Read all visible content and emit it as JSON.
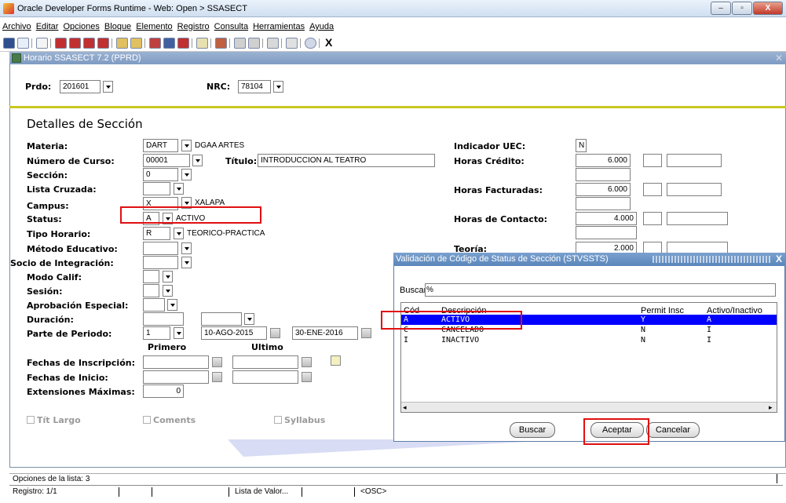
{
  "window": {
    "title": "Oracle Developer Forms Runtime - Web: Open > SSASECT",
    "min": "–",
    "max": "▫",
    "close": "X"
  },
  "menu": [
    "Archivo",
    "Editar",
    "Opciones",
    "Bloque",
    "Elemento",
    "Registro",
    "Consulta",
    "Herramientas",
    "Ayuda"
  ],
  "toolbar": {
    "exit_label": "X"
  },
  "form": {
    "title": "Horario  SSASECT 7.2  (PPRD)",
    "prdo_label": "Prdo:",
    "prdo_value": "201601",
    "nrc_label": "NRC:",
    "nrc_value": "78104",
    "section_title": "Detalles de Sección",
    "materia_label": "Materia:",
    "materia_code": "DART",
    "materia_desc": "DGAA ARTES",
    "curso_label": "Número de Curso:",
    "curso_value": "00001",
    "titulo_label": "Título:",
    "titulo_value": "INTRODUCCION AL TEATRO",
    "seccion_label": "Sección:",
    "seccion_value": "0",
    "lista_label": "Lista Cruzada:",
    "campus_label": "Campus:",
    "campus_code": "X",
    "campus_desc": "XALAPA",
    "status_label": "Status:",
    "status_code": "A",
    "status_desc": "ACTIVO",
    "tipo_label": "Tipo Horario:",
    "tipo_code": "R",
    "tipo_desc": "TEORICO-PRACTICA",
    "metodo_label": "Método Educativo:",
    "socio_label": "Socio  de  Integración:",
    "modo_label": "Modo Calif:",
    "sesion_label": "Sesión:",
    "aprob_label": "Aprobación Especial:",
    "duracion_label": "Duración:",
    "parte_label": "Parte de Periodo:",
    "parte_value": "1",
    "fecha_ini": "10-AGO-2015",
    "fecha_fin": "30-ENE-2016",
    "primero_label": "Primero",
    "ultimo_label": "Ultimo",
    "fechas_insc_label": "Fechas de Inscripción:",
    "fechas_inicio_label": "Fechas de Inicio:",
    "ext_label": "Extensiones Máximas:",
    "ext_value": "0",
    "uec_label": "Indicador UEC:",
    "uec_value": "N",
    "horas_credito_label": "Horas Crédito:",
    "horas_credito_value": "6.000",
    "horas_fact_label": "Horas Facturadas:",
    "horas_fact_value": "6.000",
    "horas_contacto_label": "Horas de Contacto:",
    "horas_contacto_value": "4.000",
    "teoria_label": "Teoría:",
    "teoria_value": "2.000",
    "tit_largo": "Tít Largo",
    "coments": "Coments",
    "syllabus": "Syllabus"
  },
  "dialog": {
    "title": "Validación de Código de Status de Sección (STVSSTS)",
    "close": "X",
    "buscar_label": "Buscar",
    "buscar_value": "%",
    "columns": [
      "Cód",
      "Descripción",
      "Permit Insc",
      "Activo/Inactivo"
    ],
    "rows": [
      {
        "code": "A",
        "desc": "ACTIVO",
        "permit": "Y",
        "activo": "A"
      },
      {
        "code": "C",
        "desc": "CANCELADO",
        "permit": "N",
        "activo": "I"
      },
      {
        "code": "I",
        "desc": "INACTIVO",
        "permit": "N",
        "activo": "I"
      }
    ],
    "btn_buscar": "Buscar",
    "btn_aceptar": "Aceptar",
    "btn_cancelar": "Cancelar"
  },
  "status": {
    "line1": "Opciones de la lista: 3",
    "registro": "Registro: 1/1",
    "lista": "Lista de Valor...",
    "osc": "<OSC>"
  },
  "colors": {
    "selection": "#0000ff",
    "highlight": "#e01010",
    "separator": "#c8c820"
  }
}
